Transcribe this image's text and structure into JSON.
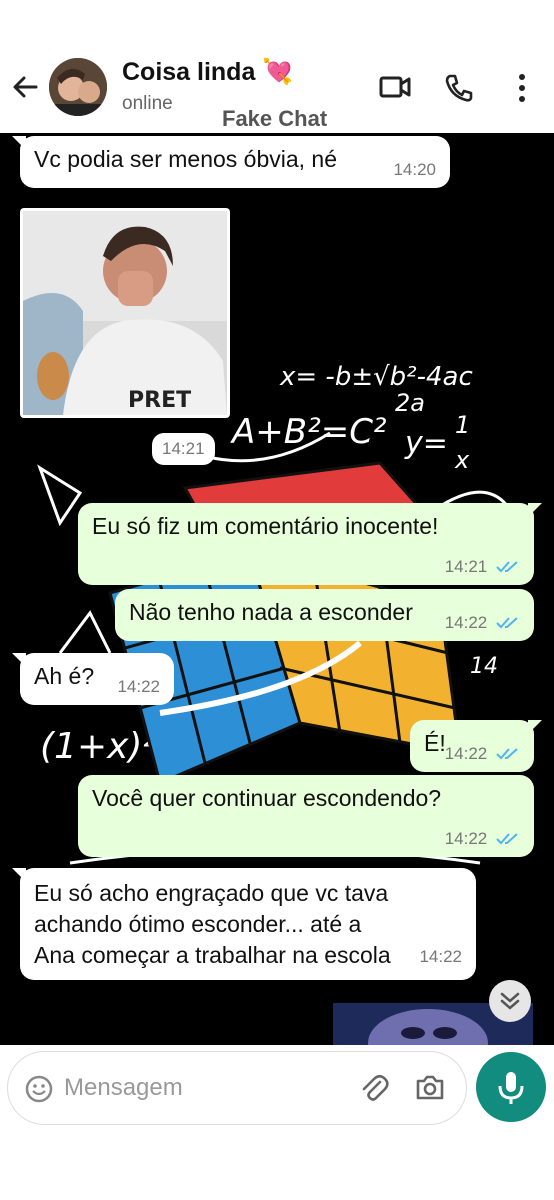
{
  "header": {
    "contact_name": "Coisa linda 💘",
    "status": "online",
    "watermark": "Fake Chat",
    "icons": [
      "back-arrow-icon",
      "video-call-icon",
      "phone-icon",
      "more-options-icon"
    ]
  },
  "messages": [
    {
      "direction": "in",
      "text": "Vc podia ser menos óbvia, né",
      "time": "14:20"
    },
    {
      "direction": "in",
      "type": "image",
      "time": "14:21"
    },
    {
      "direction": "out",
      "text": "Eu só fiz um comentário inocente!",
      "time": "14:21",
      "read": true
    },
    {
      "direction": "out",
      "text": "Não tenho nada a esconder",
      "time": "14:22",
      "read": true
    },
    {
      "direction": "in",
      "text": "Ah é?",
      "time": "14:22"
    },
    {
      "direction": "out",
      "text": "É!",
      "time": "14:22",
      "read": true
    },
    {
      "direction": "out",
      "text": "Você quer continuar escondendo?",
      "time": "14:22",
      "read": true
    },
    {
      "direction": "in",
      "text": "Eu só acho engraçado que vc tava achando ótimo esconder... até a Ana começar a trabalhar na escola",
      "time": "14:22"
    }
  ],
  "composer": {
    "placeholder": "Mensagem"
  },
  "colors": {
    "incoming": "#ffffff",
    "outgoing": "#e7ffdb",
    "read_ticks": "#4fb6ec",
    "mic_button": "#128c7e",
    "chat_background": "#000000"
  }
}
